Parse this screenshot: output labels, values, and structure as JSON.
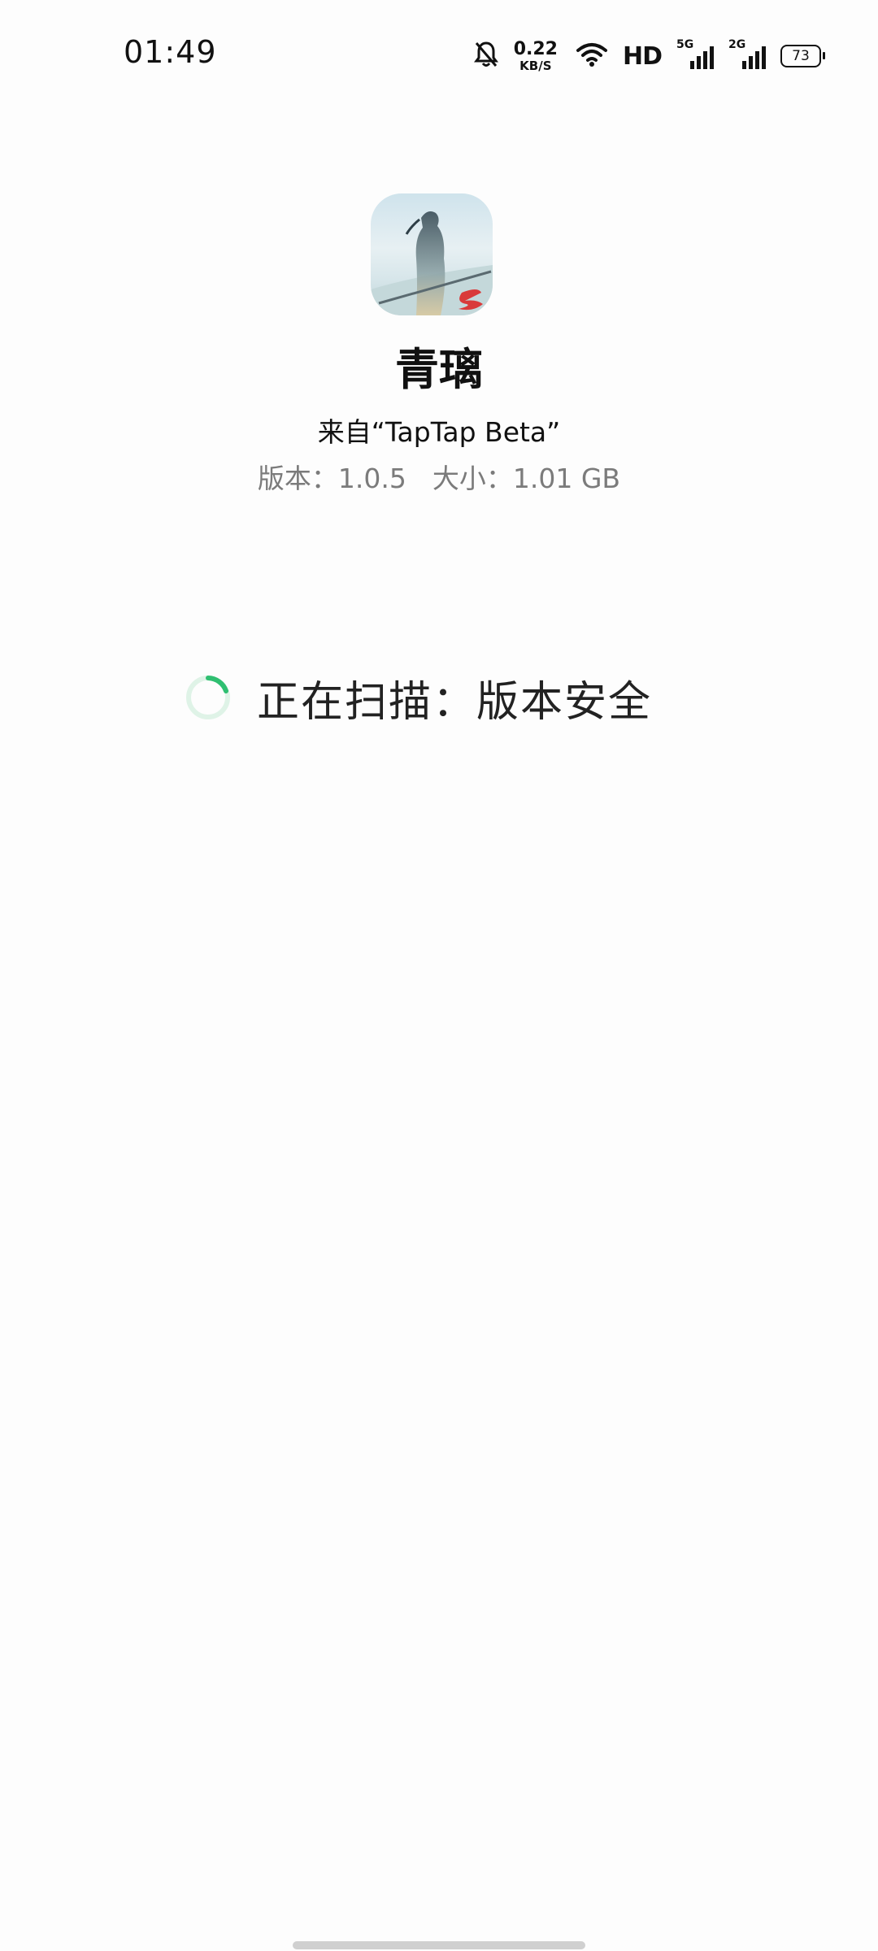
{
  "status_bar": {
    "time": "01:49",
    "net_speed_value": "0.22",
    "net_speed_unit": "KB/S",
    "hd_label": "HD",
    "signal_1_label": "5G",
    "signal_2_label": "2G",
    "battery_level": "73",
    "icons": [
      "bell-muted-icon",
      "wifi-icon",
      "cell-signal-icon",
      "battery-icon"
    ]
  },
  "app": {
    "name": "青璃",
    "source": "来自“TapTap Beta”",
    "version": "版本：1.0.5",
    "size": "大小：1.01 GB",
    "icon": "app-icon"
  },
  "scan": {
    "status_text": "正在扫描：版本安全",
    "accent_color": "#2fbf71"
  }
}
